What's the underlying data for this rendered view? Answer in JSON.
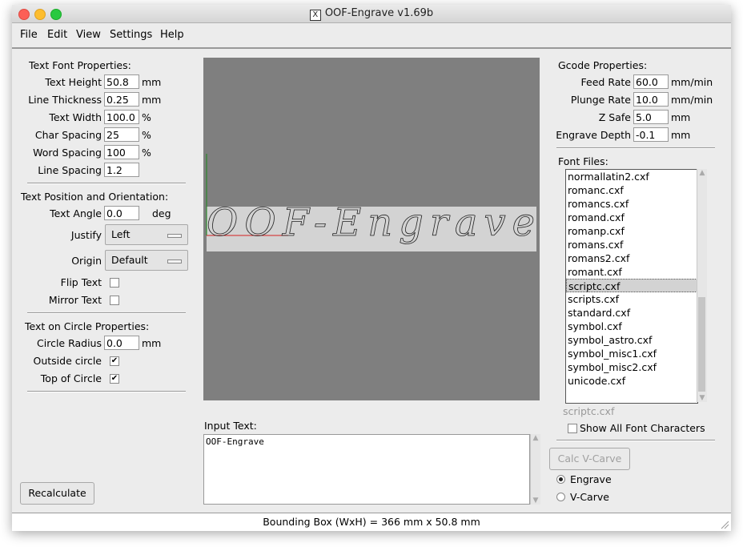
{
  "window": {
    "title": "OOF-Engrave v1.69b"
  },
  "menu": [
    "File",
    "Edit",
    "View",
    "Settings",
    "Help"
  ],
  "text_font_props": {
    "heading": "Text Font Properties:",
    "text_height": {
      "label": "Text Height",
      "value": "50.8",
      "unit": "mm"
    },
    "line_thickness": {
      "label": "Line Thickness",
      "value": "0.25",
      "unit": "mm"
    },
    "text_width": {
      "label": "Text Width",
      "value": "100.0",
      "unit": "%"
    },
    "char_spacing": {
      "label": "Char Spacing",
      "value": "25",
      "unit": "%"
    },
    "word_spacing": {
      "label": "Word Spacing",
      "value": "100",
      "unit": "%"
    },
    "line_spacing": {
      "label": "Line Spacing",
      "value": "1.2"
    }
  },
  "text_position": {
    "heading": "Text Position and Orientation:",
    "text_angle": {
      "label": "Text Angle",
      "value": "0.0",
      "unit": "deg"
    },
    "justify": {
      "label": "Justify",
      "value": "Left"
    },
    "origin": {
      "label": "Origin",
      "value": "Default"
    },
    "flip_text": {
      "label": "Flip Text",
      "checked": false
    },
    "mirror_text": {
      "label": "Mirror Text",
      "checked": false
    }
  },
  "circle_props": {
    "heading": "Text on Circle Properties:",
    "circle_radius": {
      "label": "Circle Radius",
      "value": "0.0",
      "unit": "mm"
    },
    "outside_circle": {
      "label": "Outside circle",
      "checked": true
    },
    "top_of_circle": {
      "label": "Top of Circle",
      "checked": true
    }
  },
  "recalculate_label": "Recalculate",
  "preview": {
    "text": "OOF-Engrave"
  },
  "input_text": {
    "label": "Input Text:",
    "value": "OOF-Engrave"
  },
  "gcode": {
    "heading": "Gcode Properties:",
    "feed_rate": {
      "label": "Feed Rate",
      "value": "60.0",
      "unit": "mm/min"
    },
    "plunge_rate": {
      "label": "Plunge Rate",
      "value": "10.0",
      "unit": "mm/min"
    },
    "z_safe": {
      "label": "Z Safe",
      "value": "5.0",
      "unit": "mm"
    },
    "engrave_depth": {
      "label": "Engrave Depth",
      "value": "-0.1",
      "unit": "mm"
    }
  },
  "font_files": {
    "heading": "Font Files:",
    "items": [
      "normallatin2.cxf",
      "romanc.cxf",
      "romancs.cxf",
      "romand.cxf",
      "romanp.cxf",
      "romans.cxf",
      "romans2.cxf",
      "romant.cxf",
      "scriptc.cxf",
      "scripts.cxf",
      "standard.cxf",
      "symbol.cxf",
      "symbol_astro.cxf",
      "symbol_misc1.cxf",
      "symbol_misc2.cxf",
      "unicode.cxf"
    ],
    "selected": "scriptc.cxf"
  },
  "current_font": "scriptc.cxf",
  "show_all_chars": {
    "label": "Show All Font Characters",
    "checked": false
  },
  "calc_vcarve_label": "Calc V-Carve",
  "mode": {
    "engrave": "Engrave",
    "vcarve": "V-Carve",
    "selected": "Engrave"
  },
  "status": "Bounding Box (WxH) = 366 mm  x 50.8 mm"
}
